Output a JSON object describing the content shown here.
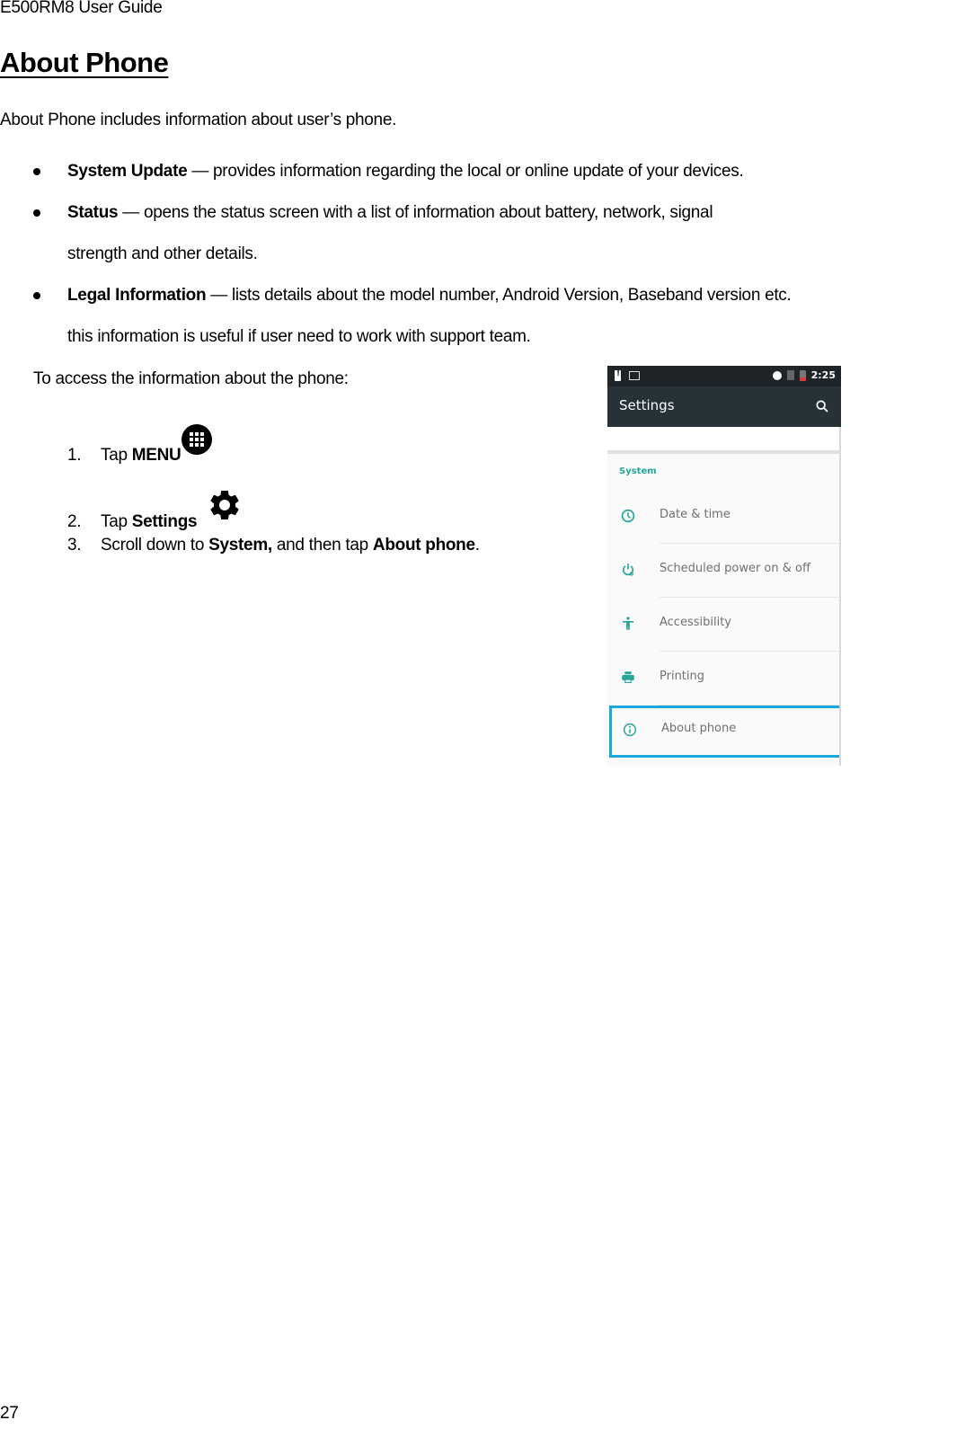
{
  "header": {
    "text": "E500RM8 User Guide"
  },
  "title": "About Phone",
  "intro": "About Phone includes information about user’s phone.",
  "bullets": [
    {
      "term": "System Update",
      "desc": " — provides information regarding the local or online update of your devices."
    },
    {
      "term": "Status",
      "desc": " — opens the status screen with a list of information about battery, network, signal",
      "desc2": "strength and other details."
    },
    {
      "term": "Legal Information",
      "desc": " — lists details about the model number, Android Version, Baseband version etc.",
      "desc2": "this information is useful if user need to work with support team."
    }
  ],
  "access_intro": "To access the information about the phone:",
  "steps": [
    {
      "num": "1.",
      "prefix": "Tap ",
      "bold": "MENU",
      "icon": "apps-grid-icon"
    },
    {
      "num": "2.",
      "prefix": "Tap ",
      "bold": "Settings",
      "icon": "gear-icon"
    },
    {
      "num": "3.",
      "prefix": "Scroll down to ",
      "bold": "System,",
      "middle": " and then tap ",
      "bold2": "About phone",
      "suffix": "."
    }
  ],
  "phone": {
    "status_bar": {
      "time": "2:25",
      "left_icons": [
        "battery-alert-icon",
        "image-icon"
      ],
      "right_icons": [
        "vibrate-icon",
        "no-sim-icon",
        "battery-low-icon"
      ]
    },
    "app_bar": {
      "title": "Settings",
      "action_icon": "search-icon"
    },
    "section": "System",
    "items": [
      {
        "label": "Date & time",
        "icon": "clock-icon"
      },
      {
        "label": "Scheduled power on & off",
        "icon": "power-schedule-icon"
      },
      {
        "label": "Accessibility",
        "icon": "accessibility-icon"
      },
      {
        "label": "Printing",
        "icon": "printer-icon"
      },
      {
        "label": "About phone",
        "icon": "info-icon",
        "highlighted": true
      }
    ],
    "colors": {
      "accent": "#26a69a",
      "app_bar": "#263238",
      "status_bar": "#1e2428",
      "highlight": "#1aa7dc"
    }
  },
  "footer": {
    "page_number": "27"
  }
}
